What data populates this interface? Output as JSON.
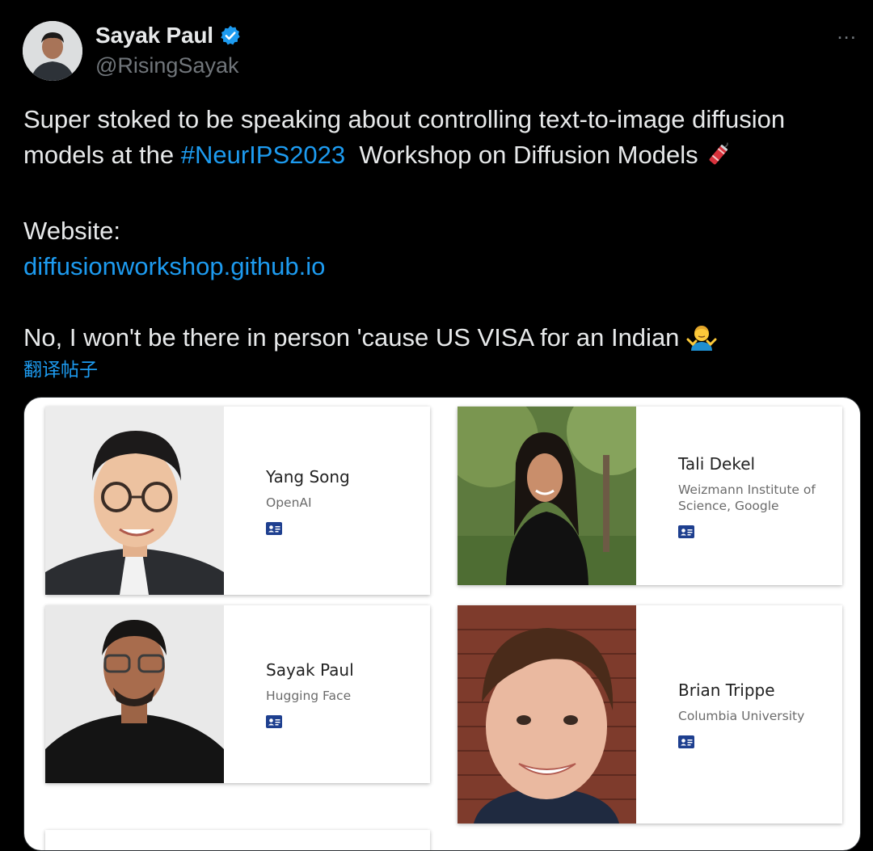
{
  "author": {
    "display_name": "Sayak Paul",
    "handle": "@RisingSayak",
    "verified": true
  },
  "more_icon": "...",
  "tweet": {
    "line1": "Super stoked to be speaking about controlling text-to-image diffusion",
    "line2_prefix": "models at the ",
    "hashtag": "#NeurIPS2023",
    "line2_suffix": "  Workshop on Diffusion Models ",
    "website_label": "Website:",
    "website_link": "diffusionworkshop.github.io",
    "line_visa": "No, I won't be there in person 'cause US VISA for an Indian "
  },
  "translate_label": "翻译帖子",
  "speakers": [
    {
      "name": "Yang Song",
      "affiliation": "OpenAI"
    },
    {
      "name": "Tali Dekel",
      "affiliation": "Weizmann Institute of Science, Google"
    },
    {
      "name": "Sayak Paul",
      "affiliation": "Hugging Face"
    },
    {
      "name": "Brian Trippe",
      "affiliation": "Columbia University"
    }
  ],
  "colors": {
    "link": "#1d9bf0",
    "verified": "#1d9bf0",
    "badge": "#1e3f8f"
  }
}
